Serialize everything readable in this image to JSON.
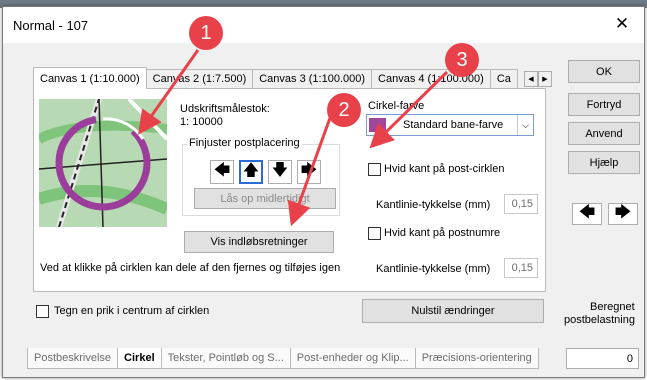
{
  "window": {
    "title": "Normal - 107",
    "close_glyph": "✕"
  },
  "side_buttons": {
    "ok": "OK",
    "undo": "Fortryd",
    "apply": "Anvend",
    "help": "Hjælp"
  },
  "tabs": [
    {
      "label": "Canvas 1  (1:10.000)",
      "active": true
    },
    {
      "label": "Canvas 2  (1:7.500)"
    },
    {
      "label": "Canvas 3  (1:100.000)"
    },
    {
      "label": "Canvas 4  (1:100.000)"
    },
    {
      "label": "Ca"
    }
  ],
  "tab_nav": {
    "left": "◀",
    "right": "▶"
  },
  "print_scale": {
    "label": "Udskriftsmålestok:",
    "value": "1: 10000"
  },
  "finetune": {
    "label": "Finjuster postplacering",
    "unlock_button": "Lås op midlertidigt"
  },
  "arrows": {
    "left": "🡄",
    "up": "🡅",
    "down": "🡇",
    "right": "🡆"
  },
  "show_directions_button": "Vis indløbsretninger",
  "circle_hint": "Ved at klikke på cirklen kan dele af den fjernes og tilføjes igen",
  "circle_color": {
    "label": "Cirkel-farve",
    "value": "Standard bane-farve",
    "swatch": "#a0469b"
  },
  "white_edge_circle": {
    "label": "Hvid kant på post-cirklen",
    "checked": false
  },
  "line_thickness_1": {
    "label": "Kantlinie-tykkelse (mm)",
    "value": "0,15"
  },
  "white_edge_numbers": {
    "label": "Hvid kant på postnumre",
    "checked": false
  },
  "line_thickness_2": {
    "label": "Kantlinie-tykkelse (mm)",
    "value": "0,15"
  },
  "center_dot": {
    "label": "Tegn en prik i centrum af cirklen",
    "checked": false
  },
  "reset_button": "Nulstil ændringer",
  "computed_load": {
    "label_line1": "Beregnet",
    "label_line2": "postbelastning",
    "value": "0"
  },
  "nav_arrows": {
    "left": "🡄",
    "right": "🡆"
  },
  "bottom_tabs": [
    {
      "label": "Postbeskrivelse"
    },
    {
      "label": "Cirkel",
      "active": true
    },
    {
      "label": "Tekster, Pointløb og S..."
    },
    {
      "label": "Post-enheder og Klip..."
    },
    {
      "label": "Præcisions-orientering"
    }
  ],
  "annotations": {
    "one": "1",
    "two": "2",
    "three": "3",
    "color": "#e8414a"
  }
}
